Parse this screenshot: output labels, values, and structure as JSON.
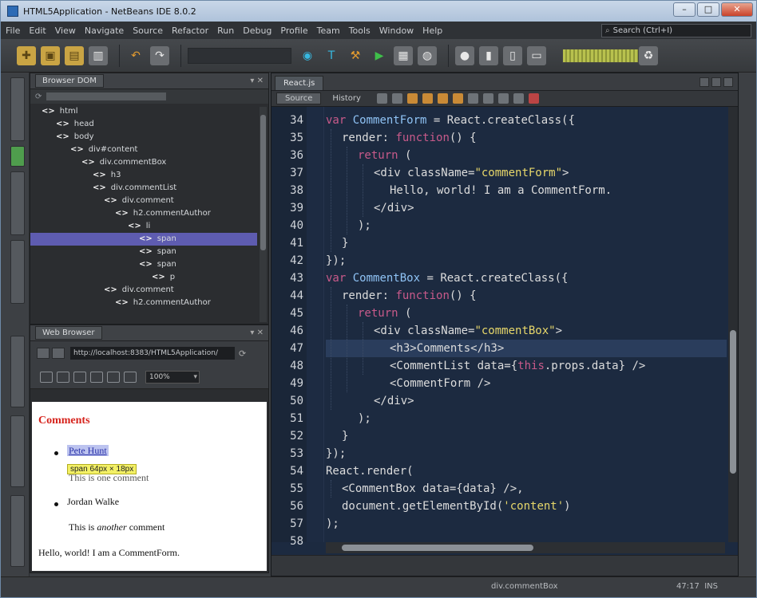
{
  "window": {
    "title": "HTML5Application - NetBeans IDE 8.0.2",
    "minimize": "–",
    "maximize": "□",
    "close": "✕"
  },
  "menu": [
    "File",
    "Edit",
    "View",
    "Navigate",
    "Source",
    "Refactor",
    "Run",
    "Debug",
    "Profile",
    "Team",
    "Tools",
    "Window",
    "Help"
  ],
  "search": {
    "placeholder": "Search (Ctrl+I)"
  },
  "dom_panel": {
    "tab": "Browser DOM",
    "controls": "▾ ✕",
    "tree": [
      {
        "label": "html"
      },
      {
        "label": "head"
      },
      {
        "label": "body"
      },
      {
        "label": "div#content"
      },
      {
        "label": "div.commentBox"
      },
      {
        "label": "h3"
      },
      {
        "label": "div.commentList"
      },
      {
        "label": "div.comment"
      },
      {
        "label": "h2.commentAuthor"
      },
      {
        "label": "li"
      },
      {
        "label": "span"
      },
      {
        "label": "span"
      },
      {
        "label": "span"
      },
      {
        "label": "p"
      },
      {
        "label": "div.comment"
      },
      {
        "label": "h2.commentAuthor"
      }
    ]
  },
  "browser_panel": {
    "tab": "Web Browser",
    "url": "http://localhost:8383/HTML5Application/",
    "zoom": "100%",
    "page": {
      "heading": "Comments",
      "author1": "Pete Hunt",
      "size_tip": "span 64px × 18px",
      "comment1": "This is one comment",
      "author2": "Jordan Walke",
      "comment2_a": "This is ",
      "comment2_em": "another",
      "comment2_b": " comment",
      "form_text": "Hello, world! I am a CommentForm."
    }
  },
  "editor": {
    "file_tab": "React.js",
    "source_tab": "Source",
    "history_tab": "History",
    "current_line": 47,
    "lines": [
      {
        "n": "34",
        "indent": 0,
        "parts": [
          [
            "kw",
            "var"
          ],
          [
            "fn",
            " "
          ],
          [
            "id",
            "CommentForm"
          ],
          [
            "fn",
            " = React.createClass({"
          ]
        ]
      },
      {
        "n": "35",
        "indent": 1,
        "parts": [
          [
            "fn",
            "render: "
          ],
          [
            "kw",
            "function"
          ],
          [
            "fn",
            "() {"
          ]
        ]
      },
      {
        "n": "36",
        "indent": 2,
        "parts": [
          [
            "kw",
            "return"
          ],
          [
            "fn",
            " ("
          ]
        ]
      },
      {
        "n": "37",
        "indent": 3,
        "parts": [
          [
            "fn",
            "<div className="
          ],
          [
            "str",
            "\"commentForm\""
          ],
          [
            "fn",
            ">"
          ]
        ]
      },
      {
        "n": "38",
        "indent": 4,
        "parts": [
          [
            "fn",
            "Hello, world! I am a CommentForm."
          ]
        ]
      },
      {
        "n": "39",
        "indent": 3,
        "parts": [
          [
            "fn",
            "</div>"
          ]
        ]
      },
      {
        "n": "40",
        "indent": 2,
        "parts": [
          [
            "fn",
            ");"
          ]
        ]
      },
      {
        "n": "41",
        "indent": 1,
        "parts": [
          [
            "fn",
            "}"
          ]
        ]
      },
      {
        "n": "42",
        "indent": 0,
        "parts": [
          [
            "fn",
            "});"
          ]
        ]
      },
      {
        "n": "43",
        "indent": 0,
        "parts": [
          [
            "kw",
            "var"
          ],
          [
            "fn",
            " "
          ],
          [
            "id",
            "CommentBox"
          ],
          [
            "fn",
            " = React.createClass({"
          ]
        ]
      },
      {
        "n": "44",
        "indent": 1,
        "parts": [
          [
            "fn",
            "render: "
          ],
          [
            "kw",
            "function"
          ],
          [
            "fn",
            "() {"
          ]
        ]
      },
      {
        "n": "45",
        "indent": 2,
        "parts": [
          [
            "kw",
            "return"
          ],
          [
            "fn",
            " ("
          ]
        ]
      },
      {
        "n": "46",
        "indent": 3,
        "parts": [
          [
            "fn",
            "<div className="
          ],
          [
            "str",
            "\"commentBox\""
          ],
          [
            "fn",
            ">"
          ]
        ]
      },
      {
        "n": "47",
        "indent": 4,
        "parts": [
          [
            "fn",
            "<h3>Comments</h3>"
          ]
        ]
      },
      {
        "n": "48",
        "indent": 4,
        "parts": [
          [
            "fn",
            "<CommentList data={"
          ],
          [
            "kw",
            "this"
          ],
          [
            "fn",
            ".props.data} />"
          ]
        ]
      },
      {
        "n": "49",
        "indent": 4,
        "parts": [
          [
            "fn",
            "<CommentForm />"
          ]
        ]
      },
      {
        "n": "50",
        "indent": 3,
        "parts": [
          [
            "fn",
            "</div>"
          ]
        ]
      },
      {
        "n": "51",
        "indent": 2,
        "parts": [
          [
            "fn",
            ");"
          ]
        ]
      },
      {
        "n": "52",
        "indent": 1,
        "parts": [
          [
            "fn",
            "}"
          ]
        ]
      },
      {
        "n": "53",
        "indent": 0,
        "parts": [
          [
            "fn",
            "});"
          ]
        ]
      },
      {
        "n": "54",
        "indent": 0,
        "parts": [
          [
            "fn",
            "React.render("
          ]
        ]
      },
      {
        "n": "55",
        "indent": 1,
        "parts": [
          [
            "fn",
            "<CommentBox data={data} />,"
          ]
        ]
      },
      {
        "n": "56",
        "indent": 1,
        "parts": [
          [
            "fn",
            "document.getElementById("
          ],
          [
            "str",
            "'content'"
          ],
          [
            "fn",
            ")"
          ]
        ]
      },
      {
        "n": "57",
        "indent": 0,
        "parts": [
          [
            "fn",
            ");"
          ]
        ]
      },
      {
        "n": "58",
        "indent": 0,
        "parts": []
      }
    ]
  },
  "status": {
    "text": "div.commentBox",
    "position": "47:17",
    "insert_mode": "INS"
  },
  "colors": {
    "keyword": "#c85a8a",
    "identifier": "#8fc3f5",
    "string": "#e7d76a",
    "editor_bg": "#1c2a40",
    "selection": "#5e5cb0"
  }
}
